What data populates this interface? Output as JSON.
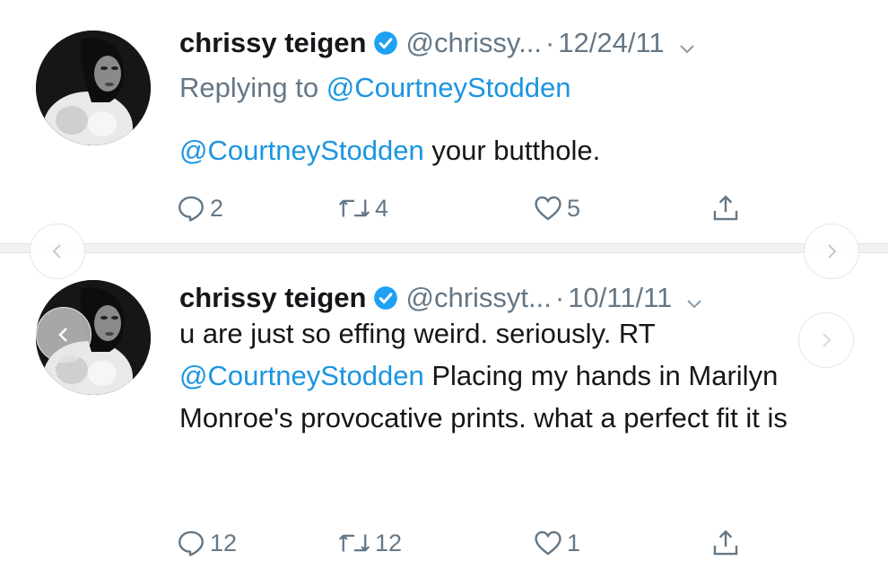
{
  "tweets": [
    {
      "name": "chrissy teigen",
      "handle": "@chrissy...",
      "dot": "·",
      "date": "12/24/11",
      "reply_prefix": "Replying to ",
      "reply_to": "@CourtneyStodden",
      "text_mention": "@CourtneyStodden",
      "text_rest": " your butthole.",
      "replies": "2",
      "retweets": "4",
      "likes": "5"
    },
    {
      "name": "chrissy teigen",
      "handle": "@chrissyt...",
      "dot": "·",
      "date": "10/11/11",
      "text_before": "u are just so effing weird. seriously. RT ",
      "text_mention": "@CourtneyStodden",
      "text_after": " Placing my hands in Marilyn Monroe's provocative prints. what a perfect fit it is",
      "replies": "12",
      "retweets": "12",
      "likes": "1"
    }
  ],
  "icons": {
    "verified": "verified-badge-icon",
    "caret": "chevron-down-icon",
    "reply": "reply-icon",
    "retweet": "retweet-icon",
    "like": "heart-icon",
    "share": "share-icon",
    "prev": "chevron-left-icon",
    "next": "chevron-right-icon"
  },
  "colors": {
    "link": "#1b95e0",
    "muted": "#657786",
    "text": "#14171a"
  }
}
